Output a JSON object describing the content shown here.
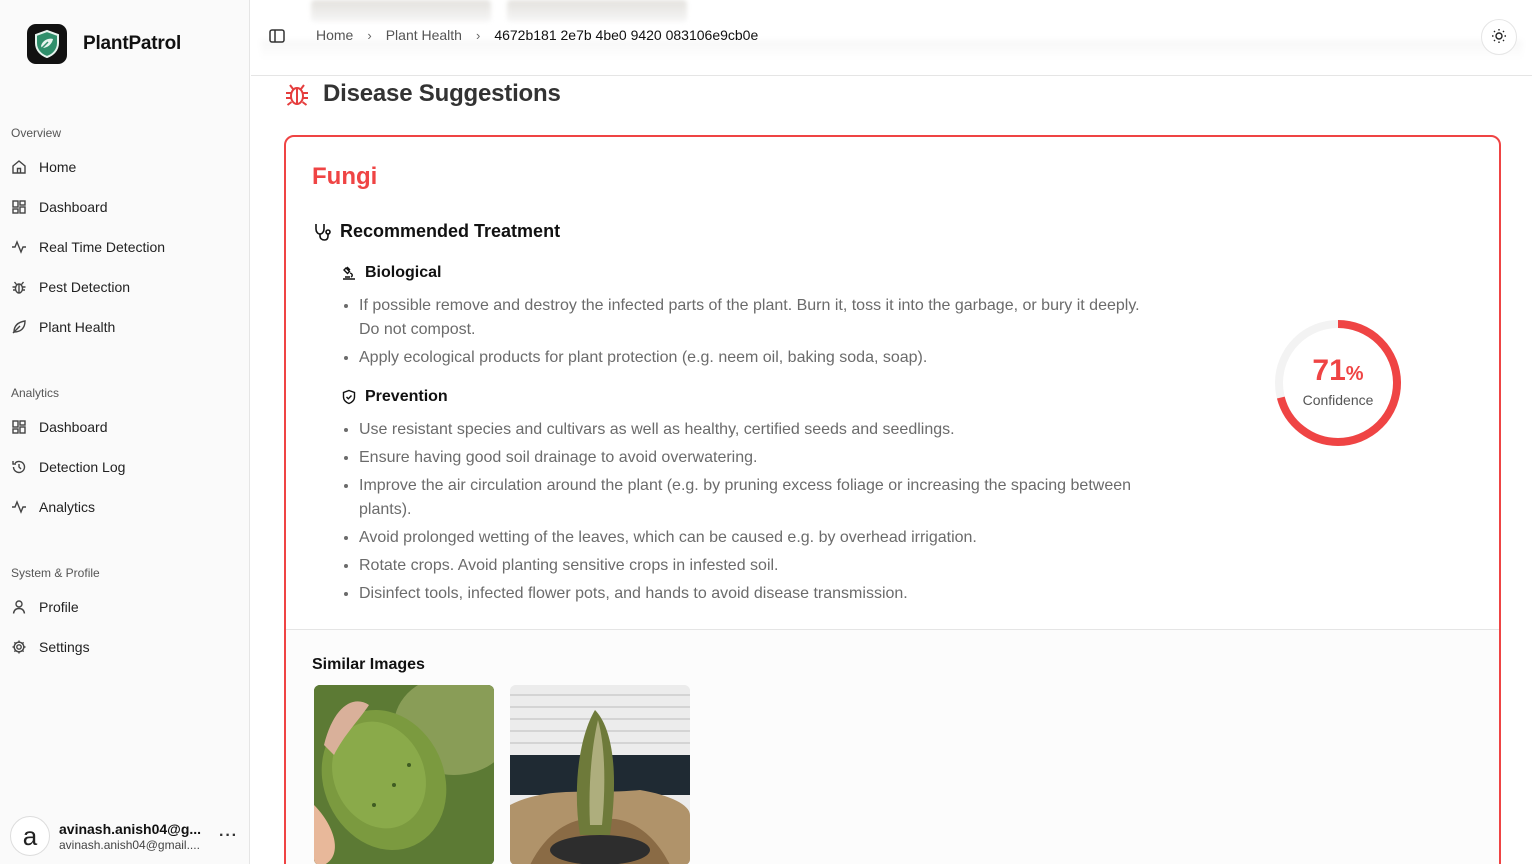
{
  "app": {
    "name": "PlantPatrol"
  },
  "sidebar": {
    "groups": [
      {
        "label": "Overview",
        "items": [
          "Home",
          "Dashboard",
          "Real Time Detection",
          "Pest Detection",
          "Plant Health"
        ]
      },
      {
        "label": "Analytics",
        "items": [
          "Dashboard",
          "Detection Log",
          "Analytics"
        ]
      },
      {
        "label": "System & Profile",
        "items": [
          "Profile",
          "Settings"
        ]
      }
    ],
    "user": {
      "avatar_letter": "a",
      "name": "avinash.anish04@g...",
      "email": "avinash.anish04@gmail...."
    }
  },
  "header": {
    "breadcrumbs": [
      "Home",
      "Plant Health",
      "4672b181 2e7b 4be0 9420 083106e9cb0e"
    ]
  },
  "main": {
    "section_title": "Disease Suggestions",
    "disease_name": "Fungi",
    "treatment_title": "Recommended Treatment",
    "biological": {
      "title": "Biological",
      "items": [
        "If possible remove and destroy the infected parts of the plant. Burn it, toss it into the garbage, or bury it deeply. Do not compost.",
        "Apply ecological products for plant protection (e.g. neem oil, baking soda, soap)."
      ]
    },
    "prevention": {
      "title": "Prevention",
      "items": [
        "Use resistant species and cultivars as well as healthy, certified seeds and seedlings.",
        "Ensure having good soil drainage to avoid overwatering.",
        "Improve the air circulation around the plant (e.g. by pruning excess foliage or increasing the spacing between plants).",
        "Avoid prolonged wetting of the leaves, which can be caused e.g. by overhead irrigation.",
        "Rotate crops. Avoid planting sensitive crops in infested soil.",
        "Disinfect tools, infected flower pots, and hands to avoid disease transmission."
      ]
    },
    "confidence": {
      "value": "71",
      "unit": "%",
      "label": "Confidence",
      "fraction": 0.71
    },
    "similar_title": "Similar Images",
    "colors": {
      "accent": "#ef4444"
    }
  }
}
